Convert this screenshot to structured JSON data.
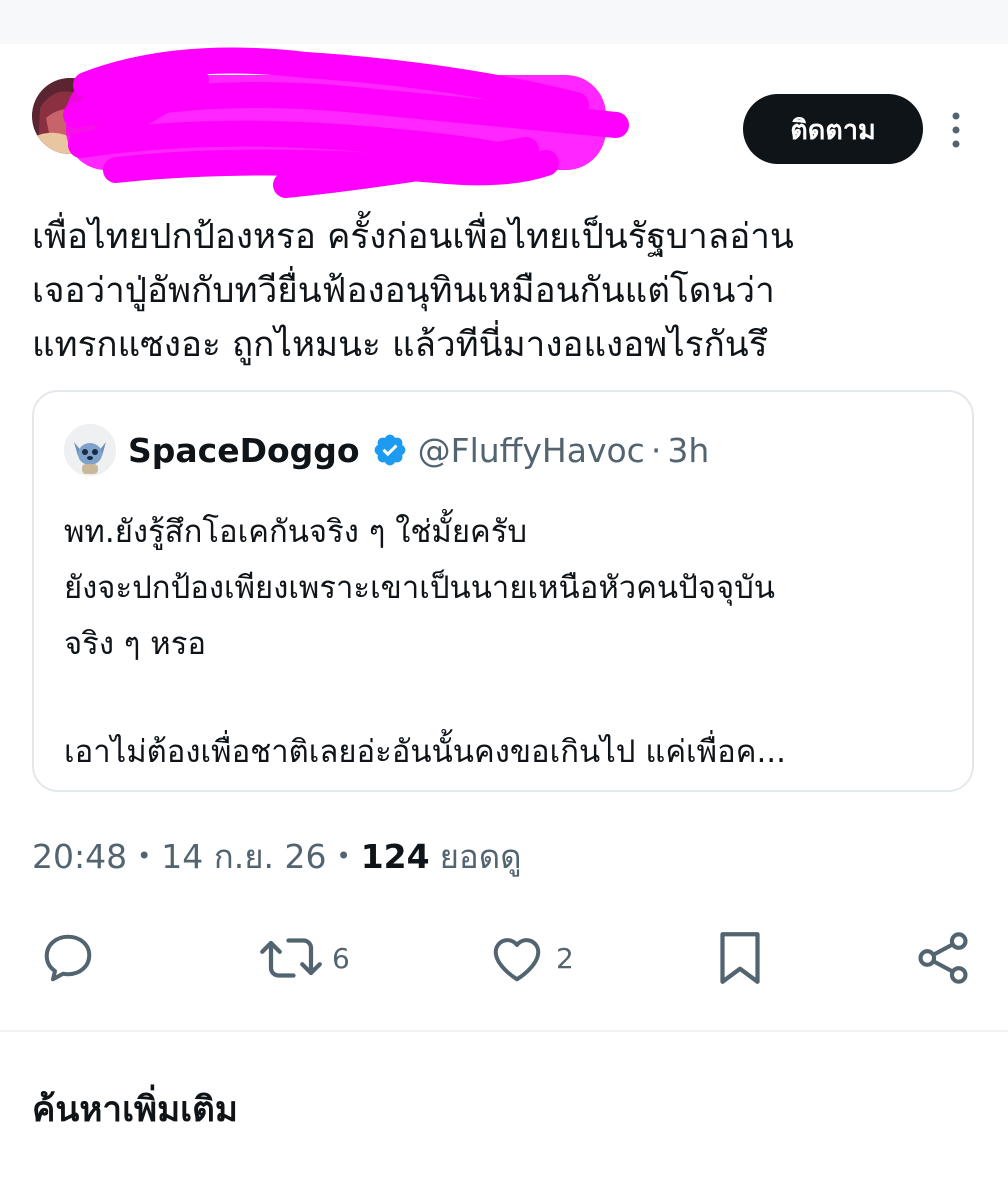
{
  "header": {
    "follow_label": "ติดตาม",
    "avatar": "user-avatar-redacted",
    "more_icon": "more-vertical-icon"
  },
  "post": {
    "text_lines": [
      "เพื่อไทยปกป้องหรอ ครั้งก่อนเพื่อไทยเป็นรัฐบาลอ่าน",
      "เจอว่าปู่อัพกับทวียื่นฟ้องอนุทินเหมือนกันแต่โดนว่า",
      "แทรกแซงอะ ถูกไหมนะ แล้วทีนี่มางอแงอพไรกันรึ"
    ]
  },
  "quote": {
    "name": "SpaceDoggo",
    "handle": "@FluffyHavoc",
    "dot": "·",
    "time": "3h",
    "body_lines": [
      "พท.ยังรู้สึกโอเคกันจริง ๆ ใช่มั้ยครับ",
      "ยังจะปกป้องเพียงเพราะเขาเป็นนายเหนือหัวคนปัจจุบัน",
      "จริง ๆ หรอ",
      "",
      "เอาไม่ต้องเพื่อชาติเลยอ่ะอันนั้นคงขอเกินไป แค่เพื่อค..."
    ],
    "verified_icon": "verified-badge-icon"
  },
  "meta": {
    "time": "20:48",
    "date": "14 ก.ย. 26",
    "sep": "•",
    "views_count": "124",
    "views_label": "ยอดดู"
  },
  "actions": {
    "reply_icon": "reply-icon",
    "retweet_icon": "retweet-icon",
    "retweet_count": "6",
    "like_icon": "heart-icon",
    "like_count": "2",
    "bookmark_icon": "bookmark-icon",
    "share_icon": "share-icon"
  },
  "section": {
    "title": "ค้นหาเพิ่มเติม"
  },
  "colors": {
    "text": "#0f1419",
    "muted": "#536471",
    "verified": "#1d9bf0",
    "redaction": "#ff00ff",
    "border": "#e3e8ec"
  }
}
